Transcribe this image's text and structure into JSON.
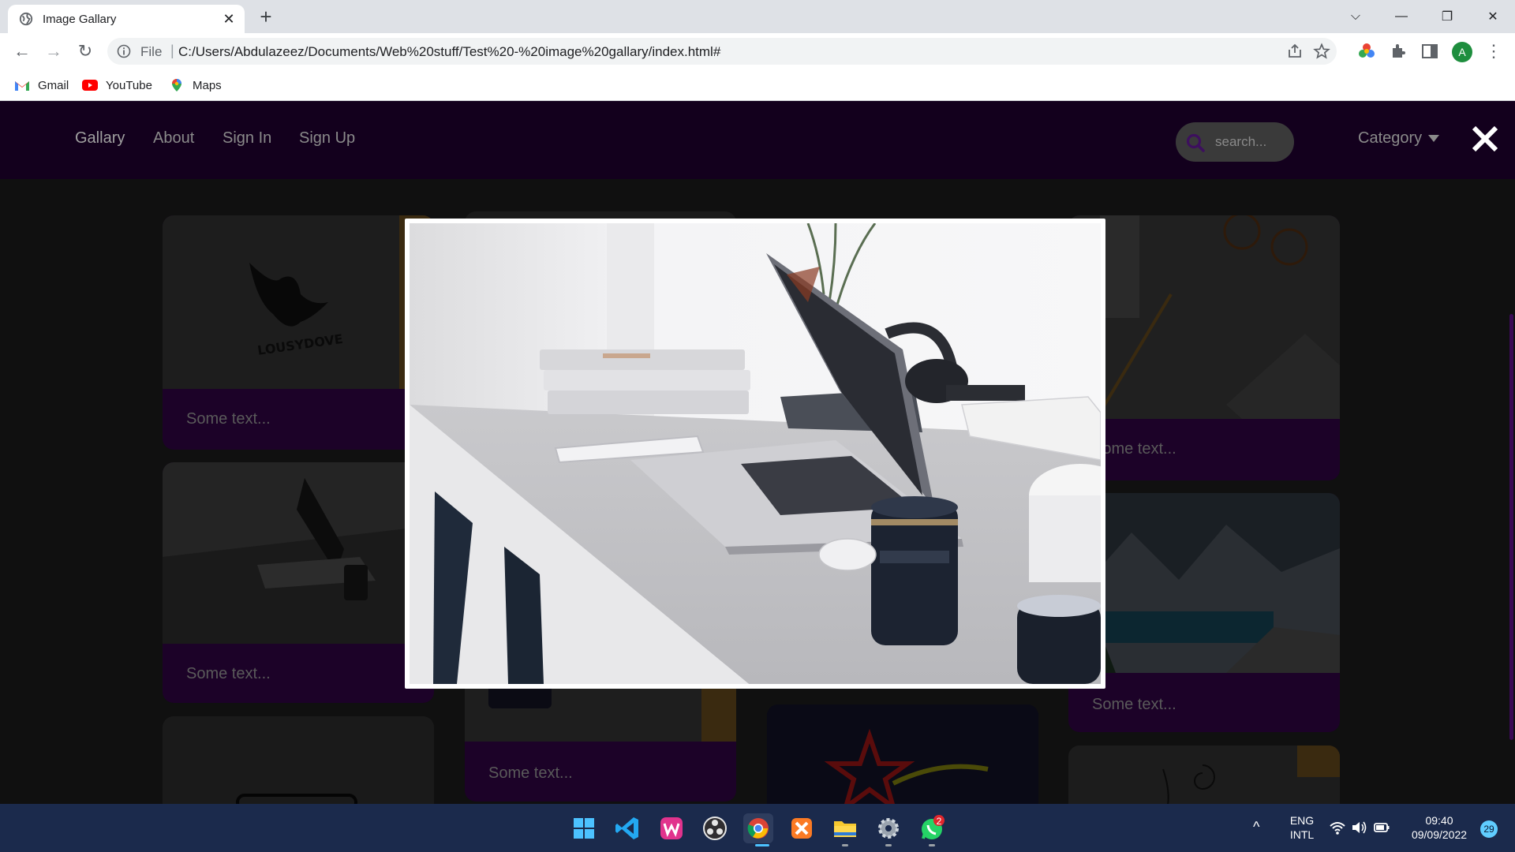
{
  "browser": {
    "tab_title": "Image Gallary",
    "omnibox_scheme_label": "File",
    "url": "C:/Users/Abdulazeez/Documents/Web%20stuff/Test%20-%20image%20gallary/index.html#",
    "profile_initial": "A",
    "bookmarks": [
      {
        "label": "Gmail",
        "icon": "gmail-icon"
      },
      {
        "label": "YouTube",
        "icon": "youtube-icon"
      },
      {
        "label": "Maps",
        "icon": "maps-icon"
      }
    ]
  },
  "site": {
    "nav": [
      {
        "label": "Gallary"
      },
      {
        "label": "About"
      },
      {
        "label": "Sign In"
      },
      {
        "label": "Sign Up"
      }
    ],
    "search_placeholder": "search...",
    "category_label": "Category",
    "accent": "#13001d",
    "card_caption_bg": "#1c0228",
    "cards": [
      {
        "caption": "Some text...",
        "image": "lousydove-logo"
      },
      {
        "caption": "Some text...",
        "image": "laptop-desk"
      },
      {
        "caption": "Some text...",
        "image": "logo-card"
      },
      {
        "caption": "Some text...",
        "image": "phone-desk"
      },
      {
        "caption": "Some text...",
        "image": "keyboard-glasses"
      },
      {
        "caption": "Some text...",
        "image": "mountain-lake"
      },
      {
        "caption": "Some text...",
        "image": "star-logo"
      },
      {
        "caption": "",
        "image": "paper-sketch"
      }
    ],
    "modal": {
      "image": "laptop-desk",
      "open": true
    }
  },
  "taskbar": {
    "apps": [
      "windows-start-icon",
      "vscode-icon",
      "wamp-icon",
      "obs-icon",
      "chrome-icon",
      "xampp-icon",
      "file-explorer-icon",
      "settings-icon",
      "whatsapp-icon"
    ],
    "whatsapp_badge": "2",
    "language_top": "ENG",
    "language_bottom": "INTL",
    "time": "09:40",
    "date": "09/09/2022",
    "notification_count": "29"
  }
}
